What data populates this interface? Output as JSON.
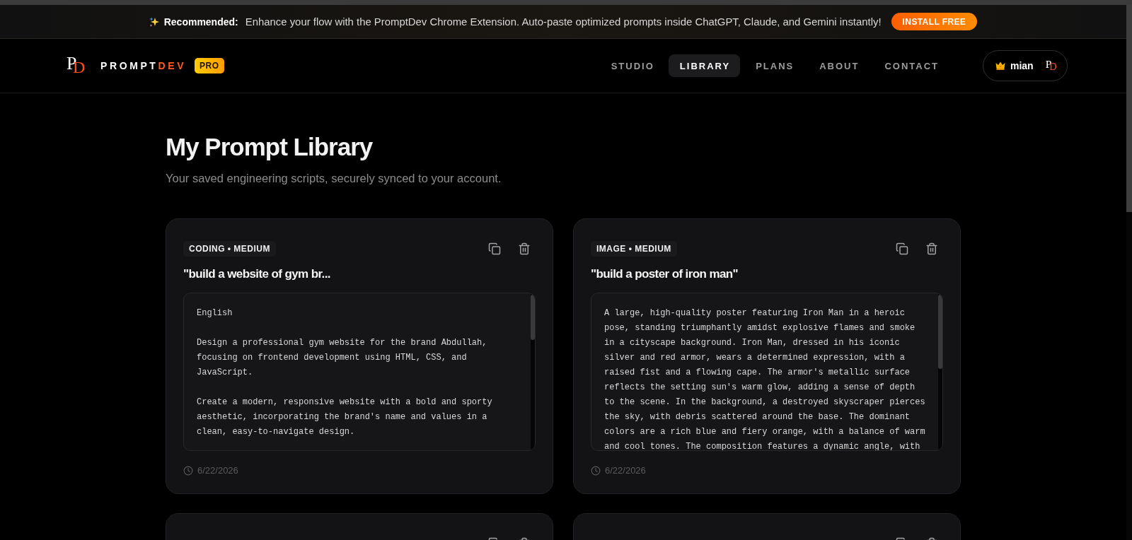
{
  "banner": {
    "label": "Recommended:",
    "message": "Enhance your flow with the PromptDev Chrome Extension. Auto-paste optimized prompts inside ChatGPT, Claude, and Gemini instantly!",
    "button": "INSTALL FREE"
  },
  "header": {
    "logo": {
      "letter_1": "P",
      "letter_2": "D"
    },
    "brand": {
      "name": "PROMPT",
      "accent": "DEV"
    },
    "badge": "PRO",
    "nav": [
      {
        "label": "STUDIO",
        "selected": false
      },
      {
        "label": "LIBRARY",
        "selected": true
      },
      {
        "label": "PLANS",
        "selected": false
      },
      {
        "label": "ABOUT",
        "selected": false
      },
      {
        "label": "CONTACT",
        "selected": false
      }
    ],
    "user": {
      "name": "mian",
      "logo": {
        "letter_1": "P",
        "letter_2": "D"
      }
    }
  },
  "library": {
    "title": "My Prompt Library",
    "subtitle": "Your saved engineering scripts, securely synced to your account."
  },
  "prompts": [
    {
      "kind": "full",
      "tag": "CODING • MEDIUM",
      "title": "\"build a website of gym br...",
      "text": "English\n\nDesign a professional gym website for the brand Abdullah, focusing on frontend development using HTML, CSS, and JavaScript.\n\nCreate a modern, responsive website with a bold and sporty aesthetic, incorporating the brand's name and values in a clean, easy-to-navigate design.",
      "date": "6/22/2026"
    },
    {
      "kind": "full",
      "tag": "IMAGE • MEDIUM",
      "title": "\"build a poster of iron man\"",
      "text": "A large, high-quality poster featuring Iron Man in a heroic pose, standing triumphantly amidst explosive flames and smoke in a cityscape background. Iron Man, dressed in his iconic silver and red armor, wears a determined expression, with a raised fist and a flowing cape. The armor's metallic surface reflects the setting sun's warm glow, adding a sense of depth to the scene. In the background, a destroyed skyscraper pierces the sky, with debris scattered around the base. The dominant colors are a rich blue and fiery orange, with a balance of warm and cool tones. The composition features a dynamic angle, with",
      "date": "6/22/2026"
    },
    {
      "kind": "cut"
    },
    {
      "kind": "cut"
    }
  ]
}
